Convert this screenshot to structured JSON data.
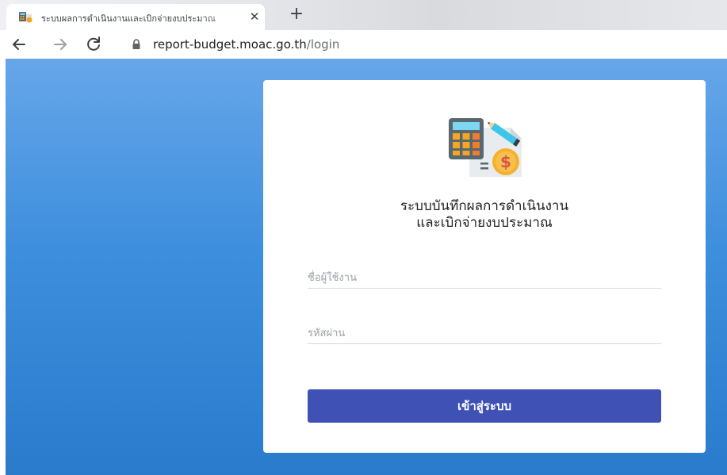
{
  "browser": {
    "tab": {
      "title": "ระบบผลการดำเนินงานและเบิกจ่ายงบประมาณ",
      "favicon": "calculator-budget-icon",
      "close_glyph": "✕"
    },
    "new_tab_glyph": "+",
    "address": {
      "host": "report-budget.moac.go.th",
      "path": "/login",
      "secure_icon": "lock-icon"
    },
    "nav_icons": [
      "back-arrow-icon",
      "forward-arrow-icon",
      "reload-icon"
    ]
  },
  "login": {
    "logo_icon": "calculator-document-dollar-icon",
    "title_line1": "ระบบบันทึกผลการดำเนินงาน",
    "title_line2": "และเบิกจ่ายงบประมาณ",
    "username": {
      "placeholder": "ชื่อผู้ใช้งาน",
      "value": ""
    },
    "password": {
      "placeholder": "รหัสผ่าน",
      "value": ""
    },
    "submit_label": "เข้าสู่ระบบ"
  },
  "colors": {
    "page_bg_top": "#66a6e9",
    "page_bg_bottom": "#2a7bcc",
    "card_bg": "#ffffff",
    "button_bg": "#3f51b5",
    "button_text": "#ffffff"
  }
}
